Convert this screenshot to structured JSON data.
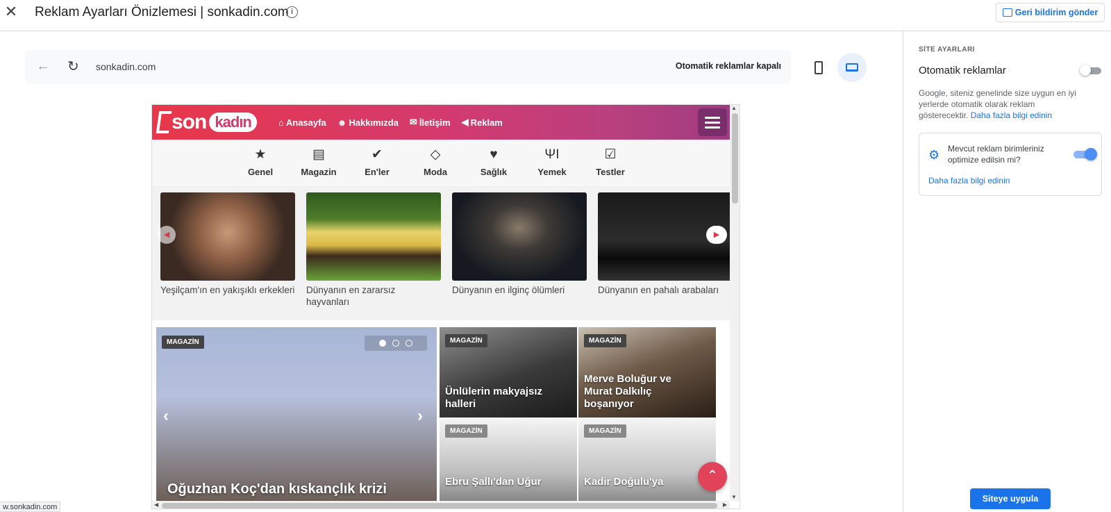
{
  "header": {
    "title": "Reklam Ayarları Önizlemesi | sonkadin.com",
    "feedback_label": "Geri bildirim gönder"
  },
  "browser": {
    "url": "sonkadin.com",
    "auto_ads_status": "Otomatik reklamlar kapalı",
    "selected_device": "desktop"
  },
  "site": {
    "logo_son": "son",
    "logo_kadin": "kadın",
    "nav": [
      {
        "icon": "home-icon",
        "label": "Anasayfa"
      },
      {
        "icon": "person-icon",
        "label": "Hakkımızda"
      },
      {
        "icon": "envelope-icon",
        "label": "İletişim"
      },
      {
        "icon": "megaphone-icon",
        "label": "Reklam"
      }
    ],
    "categories": [
      {
        "icon": "star-icon",
        "label": "Genel"
      },
      {
        "icon": "newspaper-icon",
        "label": "Magazin"
      },
      {
        "icon": "check-icon",
        "label": "En'ler"
      },
      {
        "icon": "diamond-icon",
        "label": "Moda"
      },
      {
        "icon": "heartbeat-icon",
        "label": "Sağlık"
      },
      {
        "icon": "cutlery-icon",
        "label": "Yemek"
      },
      {
        "icon": "checkbox-icon",
        "label": "Testler"
      }
    ],
    "cards": [
      {
        "caption": "Yeşilçam'ın en yakışıklı erkekleri"
      },
      {
        "caption": "Dünyanın en zararsız hayvanları"
      },
      {
        "caption": "Dünyanın en ilginç ölümleri"
      },
      {
        "caption": "Dünyanın en pahalı arabaları"
      }
    ],
    "main_news": {
      "badge": "MAGAZİN",
      "title": "Oğuzhan Koç'dan kıskançlık krizi"
    },
    "small_news": [
      {
        "badge": "MAGAZİN",
        "title": "Ünlülerin makyajsız halleri"
      },
      {
        "badge": "MAGAZİN",
        "title": "Merve Boluğur ve Murat Dalkılıç boşanıyor"
      },
      {
        "badge": "MAGAZİN",
        "title": "Ebru Şallı'dan Uğur"
      },
      {
        "badge": "MAGAZİN",
        "title": "Kadir Doğulu'ya"
      }
    ]
  },
  "status_link": "w.sonkadin.com",
  "panel": {
    "heading": "SİTE AYARLARI",
    "auto_ads_label": "Otomatik reklamlar",
    "auto_ads_enabled": false,
    "description": "Google, siteniz genelinde size uygun en iyi yerlerde otomatik olarak reklam gösterecektir.",
    "learn_more": "Daha fazla bilgi edinin",
    "optimize_question": "Mevcut reklam birimleriniz optimize edilsin mi?",
    "optimize_enabled": true,
    "optimize_learn_more": "Daha fazla bilgi edinin",
    "apply_label": "Siteye uygula"
  },
  "colors": {
    "accent": "#1a73e8",
    "site_header_start": "#e8374a",
    "site_header_end": "#9e3c80"
  }
}
